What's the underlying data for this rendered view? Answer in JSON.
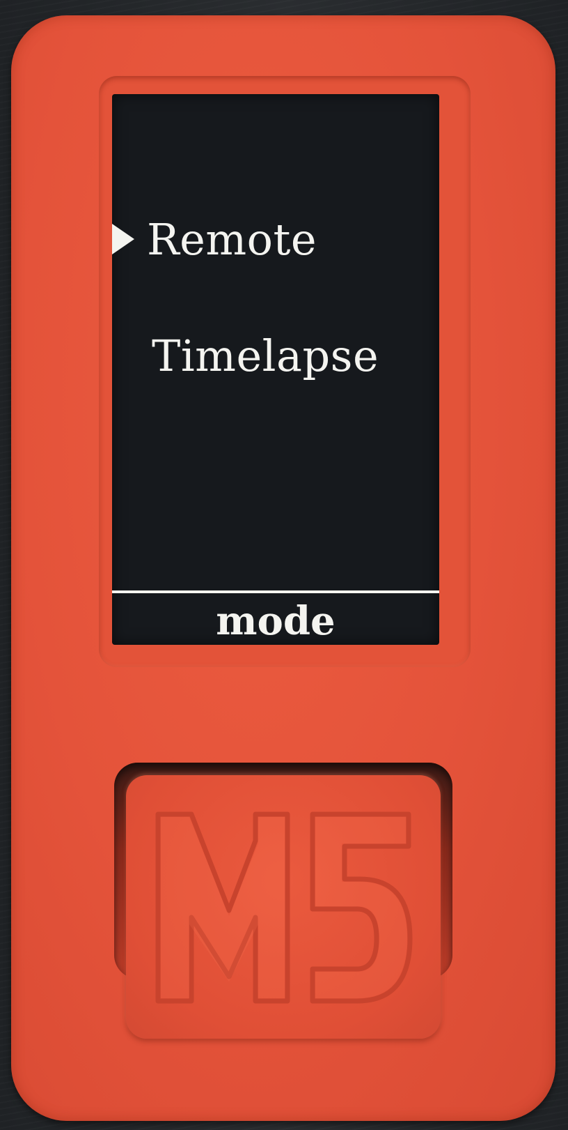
{
  "device": {
    "body_color": "#e4533a",
    "screen_color": "#16191d",
    "text_color": "#f4f4f0"
  },
  "menu": {
    "selected_index": 0,
    "items": [
      {
        "label": "Remote"
      },
      {
        "label": "Timelapse"
      }
    ]
  },
  "footer": {
    "label": "mode"
  },
  "button": {
    "logo_text": "M5",
    "icon": "m5-logo-icon"
  }
}
